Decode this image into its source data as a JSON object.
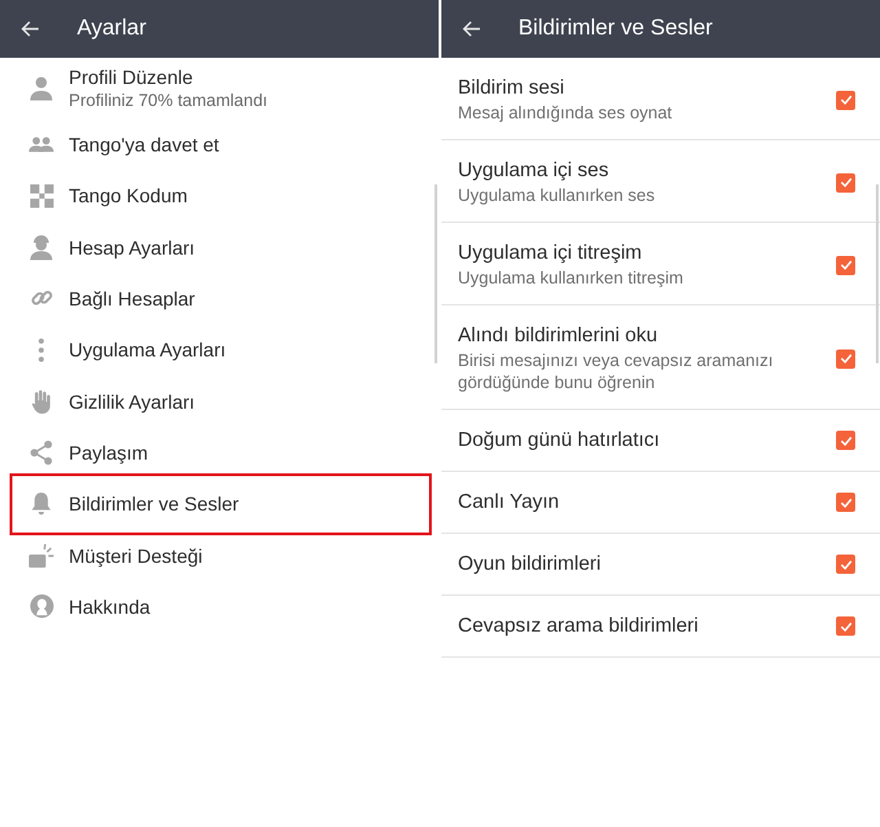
{
  "left_screen": {
    "header": {
      "title": "Ayarlar"
    },
    "items": [
      {
        "label": "Profili Düzenle",
        "subtitle": "Profiliniz 70% tamamlandı",
        "highlighted": false
      },
      {
        "label": "Tango'ya davet et",
        "highlighted": false
      },
      {
        "label": "Tango Kodum",
        "highlighted": false
      },
      {
        "label": "Hesap Ayarları",
        "highlighted": false
      },
      {
        "label": "Bağlı Hesaplar",
        "highlighted": false
      },
      {
        "label": "Uygulama Ayarları",
        "highlighted": false
      },
      {
        "label": "Gizlilik Ayarları",
        "highlighted": false
      },
      {
        "label": "Paylaşım",
        "highlighted": false
      },
      {
        "label": "Bildirimler ve Sesler",
        "highlighted": true
      },
      {
        "label": "Müşteri Desteği",
        "highlighted": false
      },
      {
        "label": "Hakkında",
        "highlighted": false
      }
    ]
  },
  "right_screen": {
    "header": {
      "title": "Bildirimler ve Sesler"
    },
    "settings": [
      {
        "title": "Bildirim sesi",
        "subtitle": "Mesaj alındığında ses oynat",
        "checked": true
      },
      {
        "title": "Uygulama içi ses",
        "subtitle": "Uygulama kullanırken ses",
        "checked": true
      },
      {
        "title": "Uygulama içi titreşim",
        "subtitle": "Uygulama kullanırken titreşim",
        "checked": true
      },
      {
        "title": "Alındı bildirimlerini oku",
        "subtitle": "Birisi mesajınızı veya cevapsız aramanızı gördüğünde bunu öğrenin",
        "checked": true
      },
      {
        "title": "Doğum günü hatırlatıcı",
        "checked": true
      },
      {
        "title": "Canlı Yayın",
        "checked": true
      },
      {
        "title": "Oyun bildirimleri",
        "checked": true
      },
      {
        "title": "Cevapsız arama bildirimleri",
        "checked": true
      }
    ]
  }
}
